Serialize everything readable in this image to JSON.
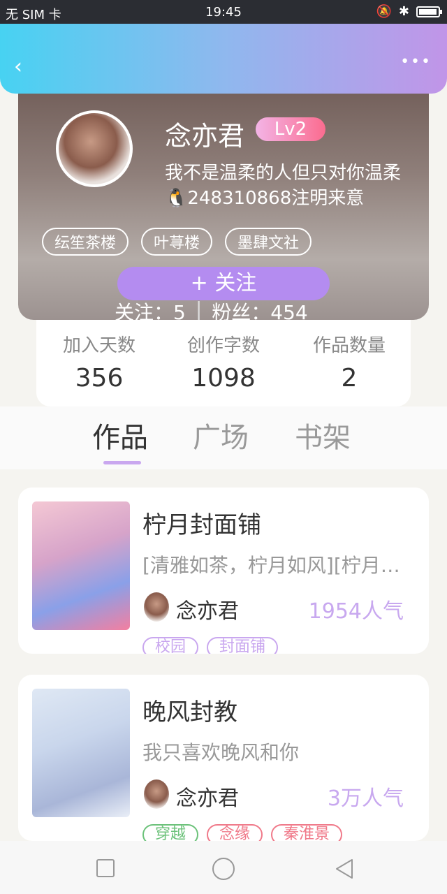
{
  "status_bar": {
    "carrier": "无 SIM 卡",
    "time": "19:45",
    "battery_level": 0.95
  },
  "header": {
    "back_icon": "back-chevron-icon",
    "more_icon": "more-dots-icon"
  },
  "profile": {
    "name": "念亦君",
    "level": "Lv2",
    "bio_line1": "我不是温柔的人但只对你温柔",
    "bio_line2": "🐧248310868注明来意",
    "tags": [
      "纭笙茶楼",
      "叶荨楼",
      "墨肆文社"
    ],
    "follow_label": "+  关注",
    "following_label": "关注：5",
    "fans_label": "粉丝：454"
  },
  "stats": [
    {
      "label": "加入天数",
      "value": "356"
    },
    {
      "label": "创作字数",
      "value": "1098"
    },
    {
      "label": "作品数量",
      "value": "2"
    }
  ],
  "tabs": [
    {
      "label": "作品",
      "active": true
    },
    {
      "label": "广场",
      "active": false
    },
    {
      "label": "书架",
      "active": false
    }
  ],
  "works": [
    {
      "title": "柠月封面铺",
      "desc": "[清雅如茶，柠月如风][柠月如风]",
      "author": "念亦君",
      "popularity": "1954人气",
      "tags": [
        {
          "label": "校园",
          "color": "#c9a7ef"
        },
        {
          "label": "封面铺",
          "color": "#c9a7ef"
        }
      ]
    },
    {
      "title": "晚风封教",
      "desc": "我只喜欢晚风和你",
      "author": "念亦君",
      "popularity": "3万人气",
      "tags": [
        {
          "label": "穿越",
          "color": "#6cc27a"
        },
        {
          "label": "念缘",
          "color": "#f07a8a"
        },
        {
          "label": "秦淮景",
          "color": "#f07a8a"
        }
      ]
    }
  ],
  "nav": {
    "icons": [
      "recent-apps-icon",
      "home-icon",
      "back-triangle-icon"
    ]
  }
}
